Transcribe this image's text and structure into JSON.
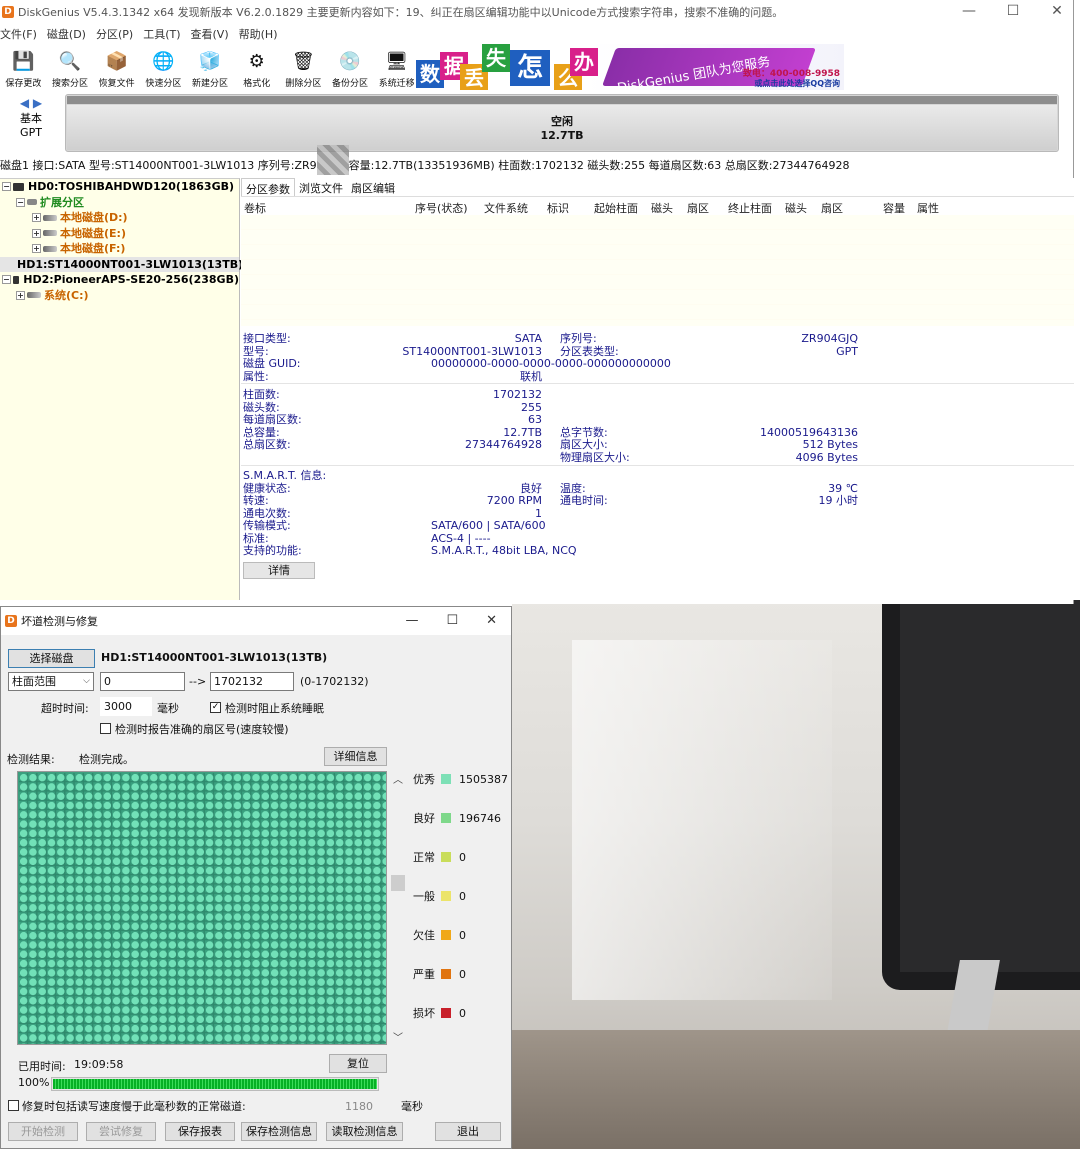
{
  "app": {
    "title": "DiskGenius V5.4.3.1342 x64   发现新版本 V6.2.0.1829   主要更新内容如下：19、纠正在扇区编辑功能中以Unicode方式搜索字符串，搜索不准确的问题。",
    "icon_letter": "D",
    "window_controls": [
      "—",
      "☐",
      "✕"
    ]
  },
  "menu": [
    "文件(F)",
    "磁盘(D)",
    "分区(P)",
    "工具(T)",
    "查看(V)",
    "帮助(H)"
  ],
  "toolbar": [
    {
      "label": "保存更改",
      "icon": "save-icon",
      "glyph": "💾"
    },
    {
      "label": "搜索分区",
      "icon": "search-icon",
      "glyph": "🔍"
    },
    {
      "label": "恢复文件",
      "icon": "recover-icon",
      "glyph": "📦"
    },
    {
      "label": "快速分区",
      "icon": "quick-partition-icon",
      "glyph": "🌐"
    },
    {
      "label": "新建分区",
      "icon": "new-partition-icon",
      "glyph": "🧊"
    },
    {
      "label": "格式化",
      "icon": "format-icon",
      "glyph": "⚙"
    },
    {
      "label": "删除分区",
      "icon": "delete-icon",
      "glyph": "🗑"
    },
    {
      "label": "备份分区",
      "icon": "backup-icon",
      "glyph": "💿"
    },
    {
      "label": "系统迁移",
      "icon": "migrate-icon",
      "glyph": "🖥"
    }
  ],
  "banner": {
    "chars": [
      "数",
      "据",
      "丢",
      "失",
      "怎",
      "么",
      "办"
    ],
    "brand": "DiskGenius 团队为您服务",
    "phone": "致电：400-008-9958",
    "qq": "或点击此处选择QQ咨询"
  },
  "disk_map": {
    "type_line1": "基本",
    "type_line2": "GPT",
    "label": "空闲",
    "size": "12.7TB"
  },
  "disk_info_line_a": "磁盘1 接口:SATA  型号:ST14000NT001-3LW1013  序列号:ZR9",
  "disk_info_line_b": "容量:12.7TB(13351936MB)  柱面数:1702132  磁头数:255  每道扇区数:63  总扇区数:27344764928",
  "tree": [
    {
      "text": "HD0:TOSHIBAHDWD120(1863GB)",
      "level": 0,
      "exp": "−",
      "type": "hd"
    },
    {
      "text": "扩展分区",
      "level": 1,
      "exp": "−",
      "type": "ext"
    },
    {
      "text": "本地磁盘(D:)",
      "level": 2,
      "exp": "+",
      "type": "part"
    },
    {
      "text": "本地磁盘(E:)",
      "level": 2,
      "exp": "+",
      "type": "part"
    },
    {
      "text": "本地磁盘(F:)",
      "level": 2,
      "exp": "+",
      "type": "part"
    },
    {
      "text": "HD1:ST14000NT001-3LW1013(13TB)",
      "level": 0,
      "exp": "",
      "type": "hd-selected"
    },
    {
      "text": "HD2:PioneerAPS-SE20-256(238GB)",
      "level": 0,
      "exp": "−",
      "type": "hd"
    },
    {
      "text": "系统(C:)",
      "level": 1,
      "exp": "+",
      "type": "part"
    }
  ],
  "tabs": [
    "分区参数",
    "浏览文件",
    "扇区编辑"
  ],
  "partition_table_headers": [
    "卷标",
    "序号(状态)",
    "文件系统",
    "标识",
    "起始柱面",
    "磁头",
    "扇区",
    "终止柱面",
    "磁头",
    "扇区",
    "容量",
    "属性"
  ],
  "disk_details": {
    "interface_label": "接口类型:",
    "interface": "SATA",
    "serial_label": "序列号:",
    "serial": "ZR904GJQ",
    "model_label": "型号:",
    "model": "ST14000NT001-3LW1013",
    "ptable_label": "分区表类型:",
    "ptable": "GPT",
    "guid_label": "磁盘 GUID:",
    "guid": "00000000-0000-0000-0000-000000000000",
    "attr_label": "属性:",
    "attr": "联机",
    "cyl_label": "柱面数:",
    "cyl": "1702132",
    "heads_label": "磁头数:",
    "heads": "255",
    "spt_label": "每道扇区数:",
    "spt": "63",
    "cap_label": "总容量:",
    "cap": "12.7TB",
    "bytes_label": "总字节数:",
    "bytes": "14000519643136",
    "sectors_label": "总扇区数:",
    "sectors": "27344764928",
    "secsize_label": "扇区大小:",
    "secsize": "512 Bytes",
    "physsec_label": "物理扇区大小:",
    "physsec": "4096 Bytes",
    "smart_label": "S.M.A.R.T. 信息:",
    "health_label": "健康状态:",
    "health": "良好",
    "temp_label": "温度:",
    "temp": "39 ℃",
    "rpm_label": "转速:",
    "rpm": "7200 RPM",
    "poweron_label": "通电时间:",
    "poweron": "19 小时",
    "powercount_label": "通电次数:",
    "powercount": "1",
    "transfer_label": "传输模式:",
    "transfer": "SATA/600 | SATA/600",
    "std_label": "标准:",
    "std": "ACS-4 | ----",
    "features_label": "支持的功能:",
    "features": "S.M.A.R.T., 48bit LBA, NCQ",
    "detail_btn": "详情"
  },
  "bad_sector": {
    "title": "坏道检测与修复",
    "select_disk_btn": "选择磁盘",
    "disk_name": "HD1:ST14000NT001-3LW1013(13TB)",
    "range_type": "柱面范围",
    "range_from": "0",
    "arrow": "-->",
    "range_to": "1702132",
    "range_hint": "(0-1702132)",
    "timeout_label": "超时时间:",
    "timeout_value": "3000",
    "timeout_unit": "毫秒",
    "prevent_sleep_label": "检测时阻止系统睡眠",
    "prevent_sleep_checked": true,
    "report_exact_label": "检测时报告准确的扇区号(速度较慢)",
    "report_exact_checked": false,
    "result_label": "检测结果:",
    "result_value": "检测完成。",
    "detail_btn": "详细信息",
    "legend": [
      {
        "label": "优秀",
        "count": "1505387",
        "color": "#7de0b6"
      },
      {
        "label": "良好",
        "count": "196746",
        "color": "#7ed88a"
      },
      {
        "label": "正常",
        "count": "0",
        "color": "#c9dd5a"
      },
      {
        "label": "一般",
        "count": "0",
        "color": "#ece46a"
      },
      {
        "label": "欠佳",
        "count": "0",
        "color": "#f0a818"
      },
      {
        "label": "严重",
        "count": "0",
        "color": "#e07410"
      },
      {
        "label": "损坏",
        "count": "0",
        "color": "#c8202a"
      }
    ],
    "elapsed_label": "已用时间:",
    "elapsed_value": "19:09:58",
    "reset_btn": "复位",
    "percent": "100%",
    "progress": 1.0,
    "repair_label": "修复时包括读写速度慢于此毫秒数的正常磁道:",
    "repair_value": "1180",
    "repair_unit": "毫秒",
    "repair_checked": false,
    "buttons": {
      "start": "开始检测",
      "try_repair": "尝试修复",
      "save_report": "保存报表",
      "save_info": "保存检测信息",
      "load_info": "读取检测信息",
      "exit": "退出"
    },
    "window_controls": [
      "—",
      "☐",
      "✕"
    ]
  }
}
